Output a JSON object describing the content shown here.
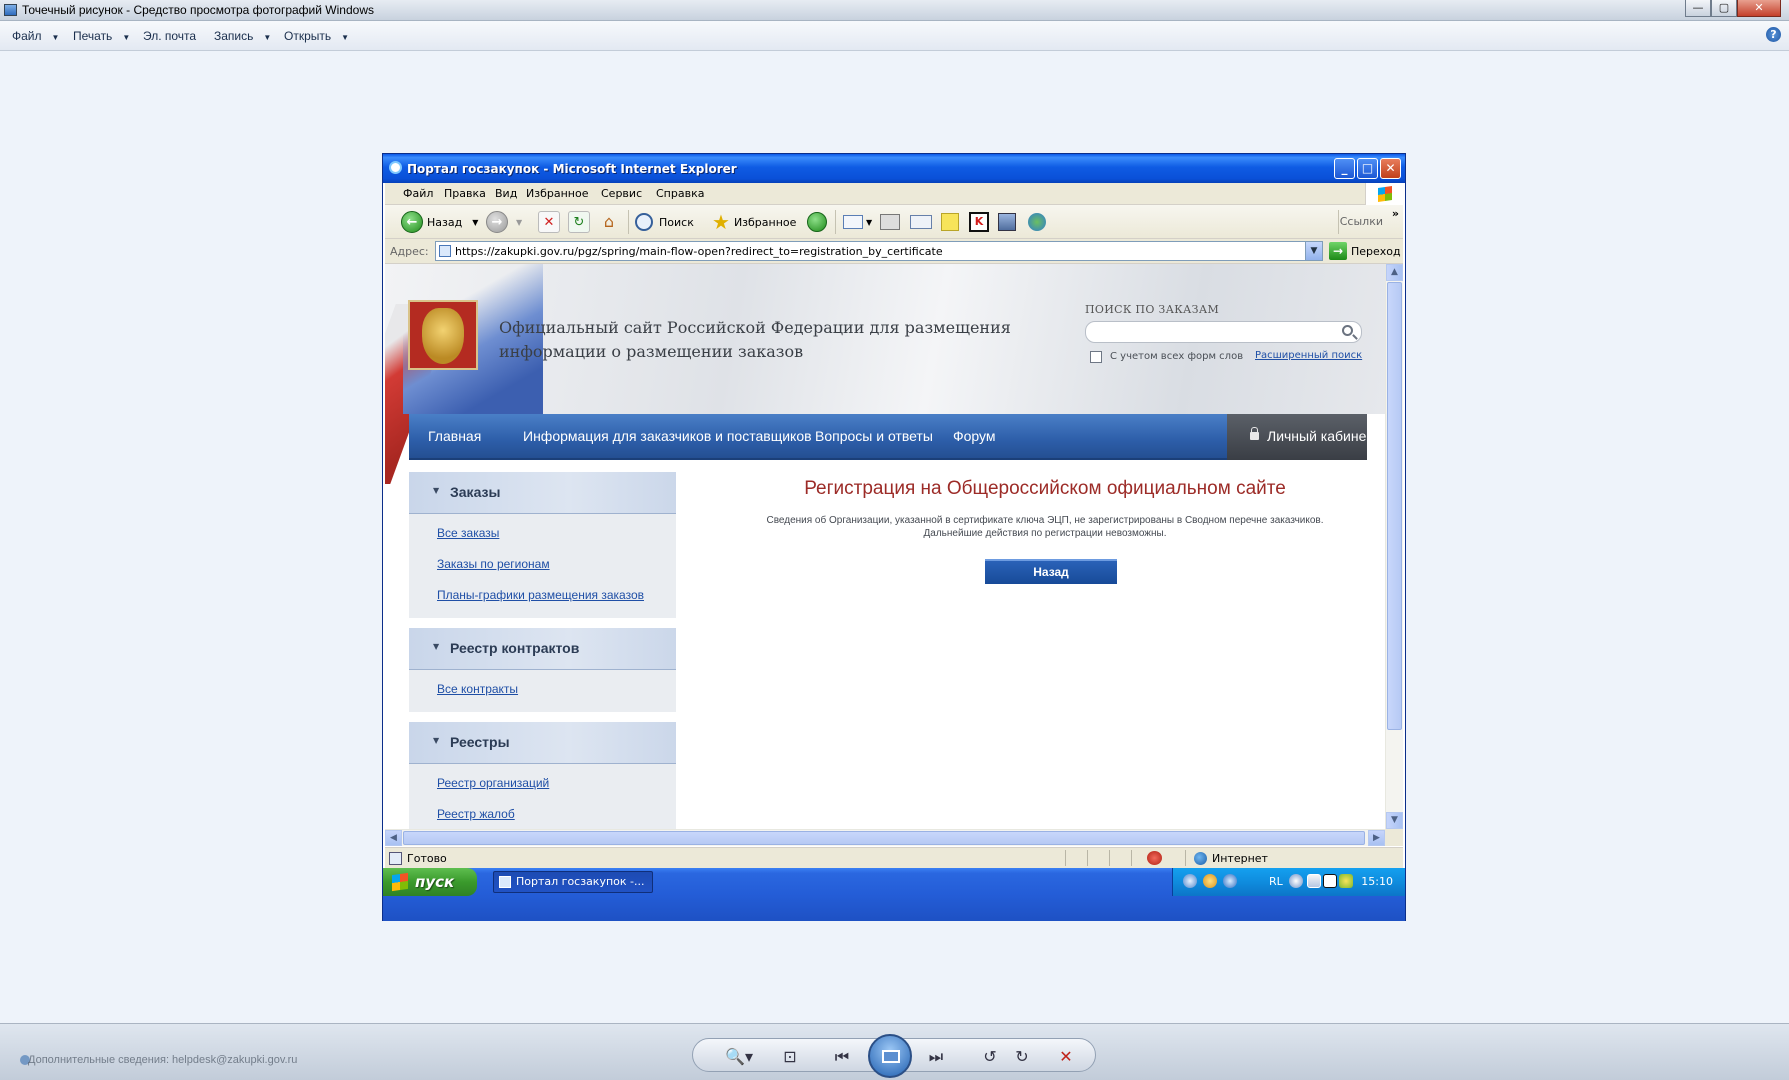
{
  "photo_viewer": {
    "title": "Точечный рисунок - Средство просмотра фотографий Windows",
    "menu": [
      {
        "label": "Файл",
        "has_dropdown": true
      },
      {
        "label": "Печать",
        "has_dropdown": true
      },
      {
        "label": "Эл. почта",
        "has_dropdown": false
      },
      {
        "label": "Запись",
        "has_dropdown": true
      },
      {
        "label": "Открыть",
        "has_dropdown": true
      }
    ],
    "help_label": "?",
    "window_buttons": {
      "minimize": "—",
      "maximize": "▢",
      "close": "✕"
    },
    "status_text": "Дополнительные сведения: helpdesk@zakupki.gov.ru",
    "controls": {
      "zoom": "🔍▾",
      "fit": "⊡",
      "prev": "⏮",
      "next": "⏭",
      "rotate_ccw": "↺",
      "rotate_cw": "↻",
      "delete": "✕"
    }
  },
  "ie": {
    "title": "Портал госзакупок - Microsoft Internet Explorer",
    "window_buttons": {
      "minimize": "_",
      "maximize": "□",
      "close": "✕"
    },
    "menu": [
      "Файл",
      "Правка",
      "Вид",
      "Избранное",
      "Сервис",
      "Справка"
    ],
    "toolbar": {
      "back": "Назад",
      "back_glyph": "←",
      "forward_glyph": "→",
      "stop_glyph": "✕",
      "refresh_glyph": "↻",
      "home_glyph": "⌂",
      "search": "Поиск",
      "favorites": "Избранное",
      "links": "Ссылки",
      "chevron": "»"
    },
    "address": {
      "label": "Адрес:",
      "url": "https://zakupki.gov.ru/pgz/spring/main-flow-open?redirect_to=registration_by_certificate",
      "go": "Переход",
      "go_glyph": "→"
    },
    "status": {
      "text": "Готово",
      "zone": "Интернет"
    }
  },
  "taskbar": {
    "start": "пуск",
    "task": "Портал госзакупок -...",
    "lang": "RL",
    "time": "15:10"
  },
  "portal": {
    "site_title": "Официальный сайт Российской Федерации для размещения информации о размещении заказов",
    "search": {
      "caption": "ПОИСК ПО ЗАКАЗАМ",
      "checkbox_label": "С учетом всех форм слов",
      "advanced_link": "Расширенный поиск"
    },
    "nav": [
      "Главная",
      "Информация для заказчиков и поставщиков",
      "Вопросы и ответы",
      "Форум"
    ],
    "personal_cabinet": "Личный кабине",
    "sidebar": [
      {
        "title": "Заказы",
        "links": [
          "Все заказы",
          "Заказы по регионам",
          "Планы-графики размещения заказов"
        ]
      },
      {
        "title": "Реестр контрактов",
        "links": [
          "Все контракты"
        ]
      },
      {
        "title": "Реестры",
        "links": [
          "Реестр организаций",
          "Реестр жалоб"
        ]
      }
    ],
    "registration": {
      "title": "Регистрация на Общероссийском официальном сайте",
      "message_line1": "Сведения об Организации, указанной в сертификате ключа ЭЦП, не зарегистрированы в Сводном перечне заказчиков.",
      "message_line2": "Дальнейшие действия по регистрации невозможны.",
      "back_button": "Назад"
    }
  }
}
